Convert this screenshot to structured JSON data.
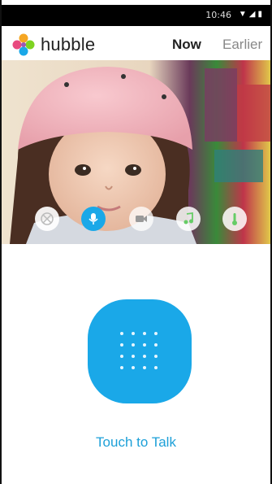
{
  "status_bar": {
    "time": "10:46",
    "icons": [
      "wifi-icon",
      "signal-icon",
      "battery-icon"
    ]
  },
  "header": {
    "logo_text": "hubble",
    "tabs": [
      {
        "label": "Now",
        "active": true
      },
      {
        "label": "Earlier",
        "active": false
      }
    ]
  },
  "camera_controls": [
    {
      "icon": "mute-icon",
      "active": false
    },
    {
      "icon": "microphone-icon",
      "active": true
    },
    {
      "icon": "video-camera-icon",
      "active": false
    },
    {
      "icon": "music-note-icon",
      "active": false
    },
    {
      "icon": "thermometer-icon",
      "active": false
    }
  ],
  "talk": {
    "label": "Touch to Talk"
  },
  "colors": {
    "accent": "#1aa8e8",
    "talk_label": "#1da0d8"
  }
}
